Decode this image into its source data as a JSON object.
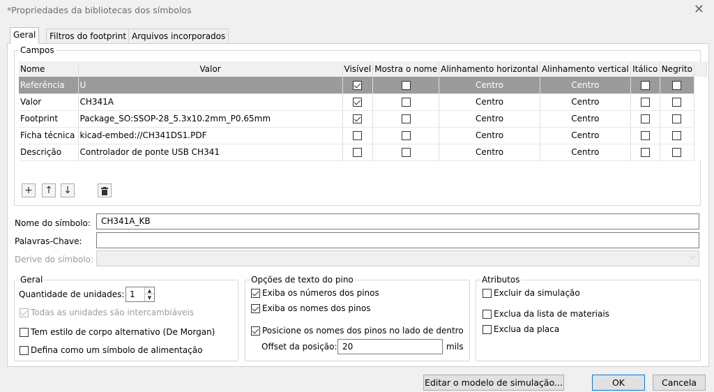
{
  "window": {
    "title": "*Propriedades da bibliotecas dos símbolos",
    "close_icon": "close-icon"
  },
  "tabs": [
    "Geral",
    "Filtros do footprint",
    "Arquivos incorporados"
  ],
  "campos": {
    "label": "Campos",
    "columns": [
      "Nome",
      "Valor",
      "Visível",
      "Mostra o nome",
      "Alinhamento horizontal",
      "Alinhamento vertical",
      "Itálico",
      "Negrito"
    ],
    "rows": [
      {
        "nome": "Referência",
        "valor": "U",
        "visivel": true,
        "mostra_nome": false,
        "h_align": "Centro",
        "v_align": "Centro",
        "italico": false,
        "negrito": false
      },
      {
        "nome": "Valor",
        "valor": "CH341A",
        "visivel": true,
        "mostra_nome": false,
        "h_align": "Centro",
        "v_align": "Centro",
        "italico": false,
        "negrito": false
      },
      {
        "nome": "Footprint",
        "valor": "Package_SO:SSOP-28_5.3x10.2mm_P0.65mm",
        "visivel": true,
        "mostra_nome": false,
        "h_align": "Centro",
        "v_align": "Centro",
        "italico": false,
        "negrito": false
      },
      {
        "nome": "Ficha técnica",
        "valor": "kicad-embed://CH341DS1.PDF",
        "visivel": false,
        "mostra_nome": false,
        "h_align": "Centro",
        "v_align": "Centro",
        "italico": false,
        "negrito": false
      },
      {
        "nome": "Descrição",
        "valor": "Controlador de ponte USB CH341",
        "visivel": false,
        "mostra_nome": false,
        "h_align": "Centro",
        "v_align": "Centro",
        "italico": false,
        "negrito": false
      }
    ],
    "toolbar_icons": [
      "add-icon",
      "arrow-up-icon",
      "arrow-down-icon",
      "trash-icon"
    ]
  },
  "fields": {
    "nome_label": "Nome do símbolo:",
    "nome_value": "CH341A_KB",
    "palavras_label": "Palavras-Chave:",
    "palavras_value": "",
    "derive_label": "Derive do símbolo:",
    "derive_value": ""
  },
  "geral": {
    "label": "Geral",
    "unidades_label": "Quantidade de unidades:",
    "unidades_value": "1",
    "intercambiaveis": {
      "label": "Todas as unidades são intercambiáveis",
      "checked": true,
      "disabled": true
    },
    "de_morgan": {
      "label": "Tem estilo de corpo alternativo (De Morgan)",
      "checked": false
    },
    "alimentacao": {
      "label": "Defina como um símbolo de alimentação",
      "checked": false
    }
  },
  "pino": {
    "label": "Opções de texto do pino",
    "numeros": {
      "label": "Exiba os números dos pinos",
      "checked": true
    },
    "nomes": {
      "label": "Exiba os nomes dos pinos",
      "checked": true
    },
    "dentro": {
      "label": "Posicione os nomes dos pinos no lado de dentro",
      "checked": true
    },
    "offset_label": "Offset da posição:",
    "offset_value": "20",
    "offset_unit": "mils"
  },
  "atributos": {
    "label": "Atributos",
    "simulacao": {
      "label": "Excluir da simulação",
      "checked": false
    },
    "materiais": {
      "label": "Exclua da lista de materiais",
      "checked": false
    },
    "placa": {
      "label": "Exclua da placa",
      "checked": false
    }
  },
  "buttons": {
    "sim_model": "Editar o modelo de simulação...",
    "ok": "OK",
    "cancel": "Cancela"
  }
}
